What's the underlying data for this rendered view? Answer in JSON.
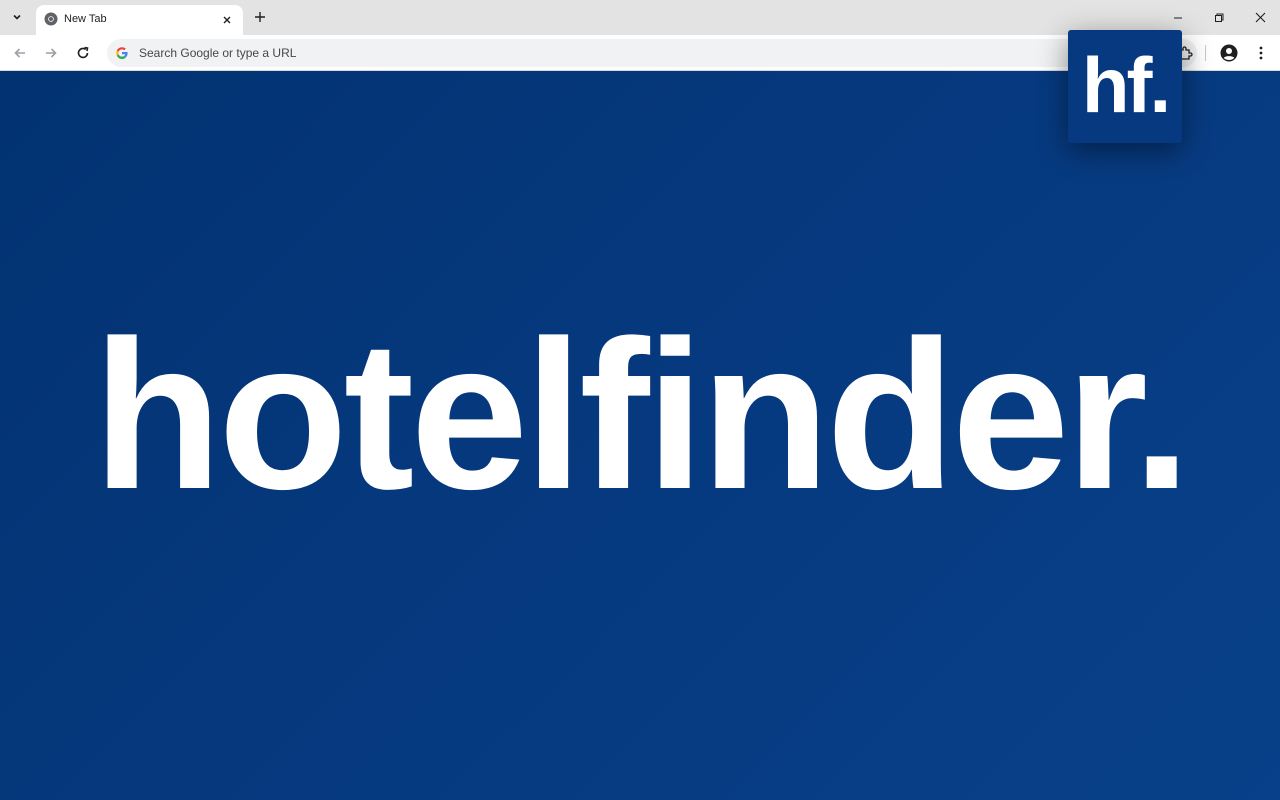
{
  "browser": {
    "tab_title": "New Tab",
    "omnibox_placeholder": "Search Google or type a URL"
  },
  "page": {
    "wordmark": "hotelfinder."
  },
  "extension_badge": {
    "text": "hf."
  },
  "icons": {
    "tab_search": "chevron-down-icon",
    "favicon": "chrome-icon",
    "tab_close": "close-icon",
    "new_tab": "plus-icon",
    "minimize": "minimize-icon",
    "restore": "restore-icon",
    "close_window": "close-icon",
    "back": "back-arrow-icon",
    "forward": "forward-arrow-icon",
    "reload": "reload-icon",
    "google": "google-g-icon",
    "extensions": "puzzle-icon",
    "profile": "profile-icon",
    "menu": "kebab-menu-icon"
  },
  "colors": {
    "brand_blue": "#06397f",
    "text_on_brand": "#ffffff"
  }
}
